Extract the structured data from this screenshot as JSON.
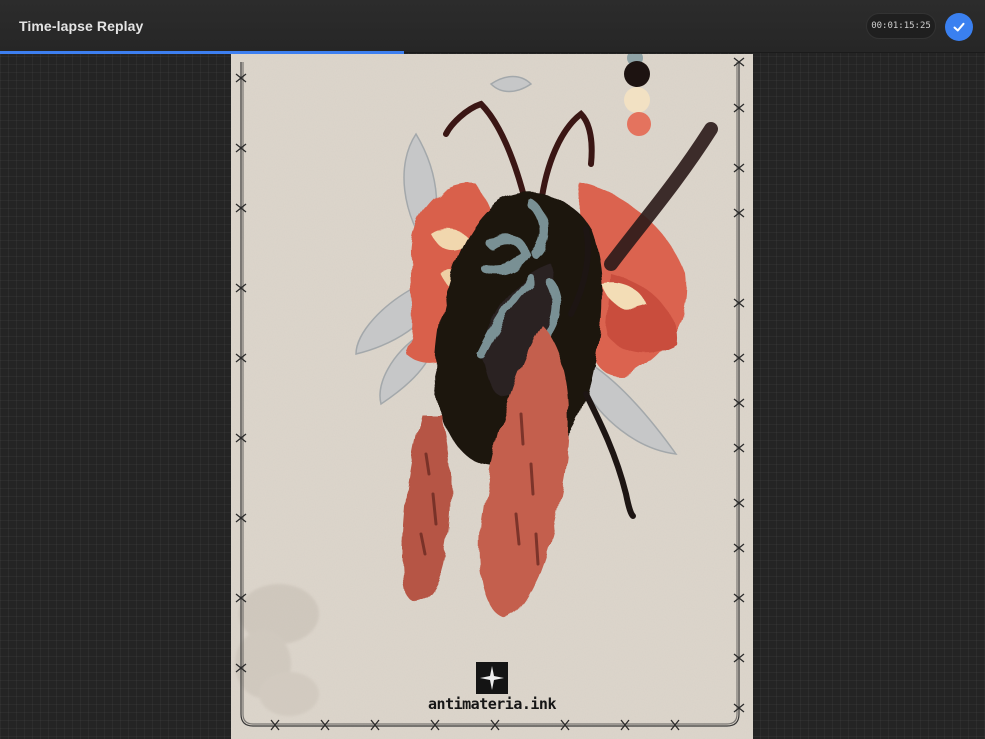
{
  "header": {
    "title": "Time-lapse Replay",
    "timecode": "00:01:15:25",
    "done_icon": "checkmark-icon"
  },
  "playback": {
    "progress_fraction": 0.41
  },
  "artwork": {
    "watermark": "antimateria.ink"
  },
  "colors": {
    "accent": "#3a80f0",
    "background": "#242424",
    "paper": "#ddd6cc"
  }
}
